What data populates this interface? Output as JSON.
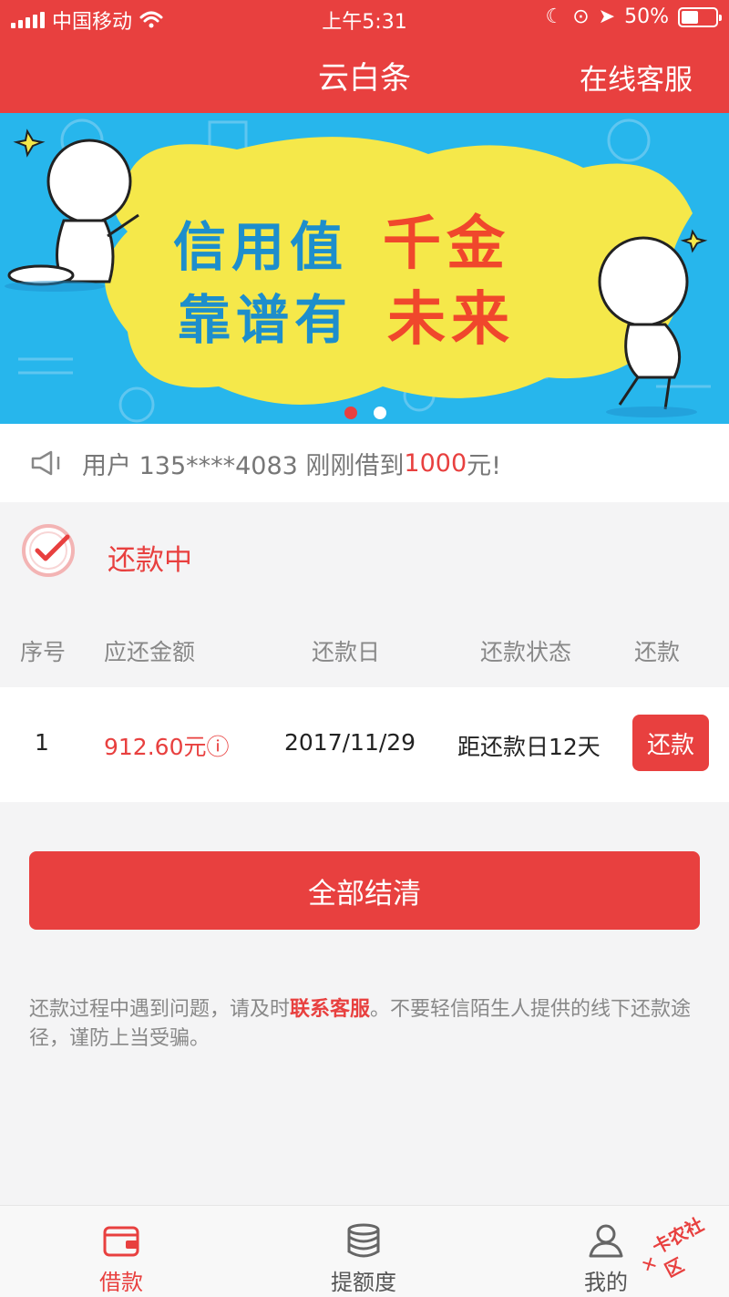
{
  "status_bar": {
    "carrier": "中国移动",
    "time": "上午5:31",
    "battery": "50%"
  },
  "navbar": {
    "title": "云白条",
    "service_label": "在线客服"
  },
  "banner": {
    "line1_blue": "信用值",
    "line1_red": "千金",
    "line2_blue": "靠谱有",
    "line2_red": "未来",
    "slide_count": 2,
    "active_slide": 1
  },
  "notice": {
    "prefix": "用户 135****4083 刚刚借到",
    "amount": "1000",
    "suffix": "元!"
  },
  "repayment": {
    "status_label": "还款中"
  },
  "table": {
    "headers": [
      "序号",
      "应还金额",
      "还款日",
      "还款状态",
      "还款"
    ],
    "rows": [
      {
        "index": "1",
        "amount": "912.60元ⓘ",
        "date": "2017/11/29",
        "status": "距还款日12天",
        "button": "还款"
      }
    ]
  },
  "settle_button": "全部结清",
  "tip": {
    "before": "还款过程中遇到问题，请及时",
    "link": "联系客服",
    "after": "。不要轻信陌生人提供的线下还款途径，谨防上当受骗。"
  },
  "tabbar": {
    "items": [
      {
        "label": "借款",
        "icon": "wallet-icon",
        "active": true
      },
      {
        "label": "提额度",
        "icon": "database-icon",
        "active": false
      },
      {
        "label": "我的",
        "icon": "user-icon",
        "active": false
      }
    ]
  },
  "watermark": "卡农社区",
  "colors": {
    "primary": "#e8403f",
    "banner_bg": "#27b6ec",
    "banner_splash": "#f5e84a"
  }
}
